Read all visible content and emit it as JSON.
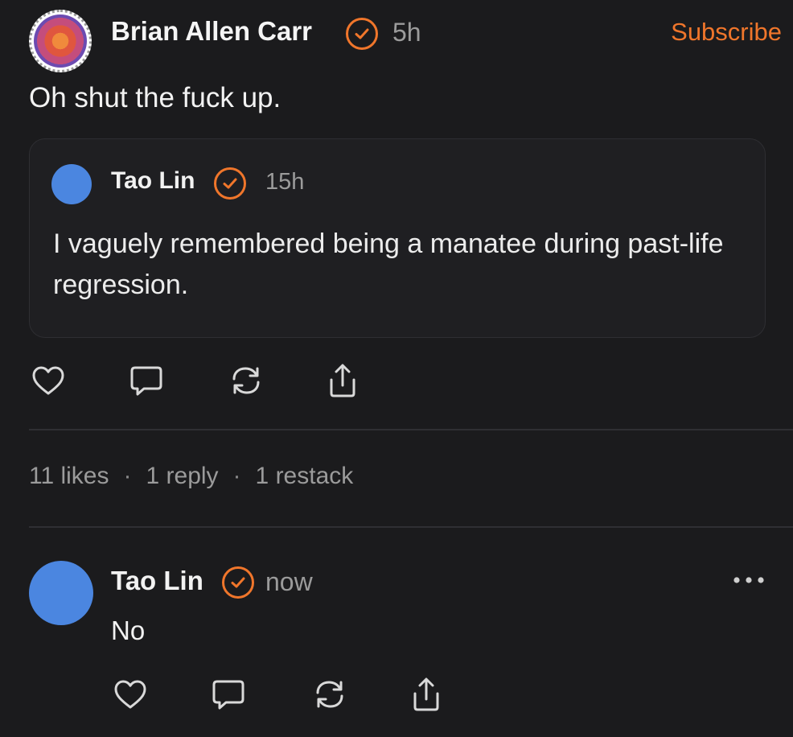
{
  "post": {
    "author": "Brian Allen Carr",
    "time": "5h",
    "subscribe_label": "Subscribe",
    "body": "Oh shut the fuck up.",
    "verified_icon": "verified-badge-icon",
    "quote": {
      "author": "Tao Lin",
      "time": "15h",
      "text": "I vaguely remembered being a manatee during past-life regression."
    },
    "stats": {
      "likes": "11 likes",
      "replies": "1 reply",
      "restacks": "1 restack",
      "separator": "·"
    }
  },
  "reply": {
    "author": "Tao Lin",
    "time": "now",
    "text": "No",
    "more_label": "•••"
  },
  "actions": [
    "heart-icon",
    "comment-icon",
    "restack-icon",
    "share-icon"
  ],
  "colors": {
    "background": "#1b1b1d",
    "accent": "#f0762b",
    "muted_text": "#9b9b9b",
    "avatar_blue": "#4b86e0"
  }
}
